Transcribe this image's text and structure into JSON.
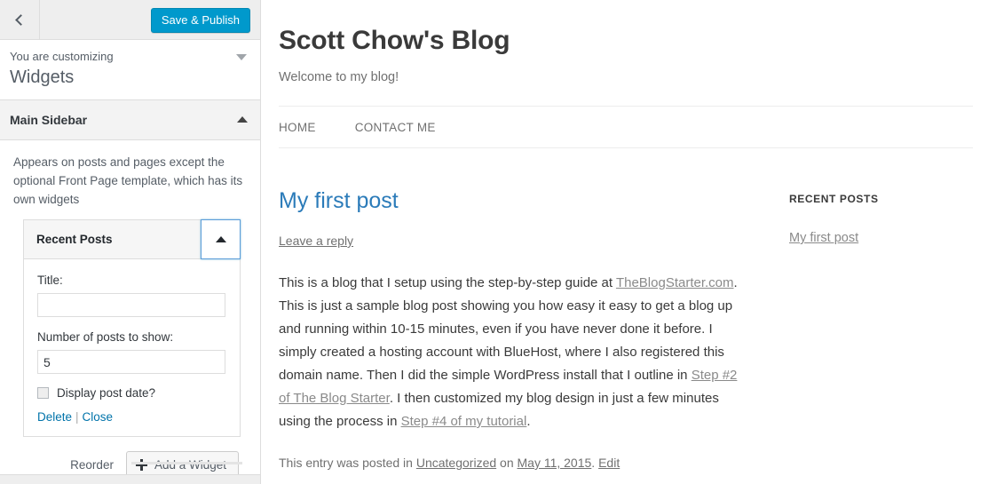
{
  "customizer": {
    "back_icon": "chevron-left-icon",
    "save_label": "Save & Publish",
    "accent_color": "#0099cc",
    "panel": {
      "eyebrow": "You are customizing",
      "title": "Widgets",
      "caret_icon": "caret-down-icon"
    },
    "section": {
      "label": "Main Sidebar",
      "caret_icon": "caret-up-icon",
      "description": "Appears on posts and pages except the optional Front Page template, which has its own widgets"
    },
    "widget": {
      "title": "Recent Posts",
      "toggle_icon": "caret-up-icon",
      "fields": {
        "title_label": "Title:",
        "title_value": "",
        "title_placeholder": "",
        "count_label": "Number of posts to show:",
        "count_value": "5",
        "checkbox_label": "Display post date?",
        "checkbox_checked": false
      },
      "actions": {
        "delete_label": "Delete",
        "separator": "|",
        "close_label": "Close"
      }
    },
    "footer": {
      "reorder_label": "Reorder",
      "add_widget_label": "Add a Widget",
      "add_widget_icon": "plus-icon"
    }
  },
  "preview": {
    "site_title": "Scott Chow's Blog",
    "site_description": "Welcome to my blog!",
    "nav": [
      {
        "label": "HOME"
      },
      {
        "label": "CONTACT ME"
      }
    ],
    "post": {
      "title": "My first post",
      "reply_link": "Leave a reply",
      "body": {
        "p1_a": "This is a blog that I setup using the step-by-step guide at ",
        "p1_link1": "TheBlogStarter.com",
        "p1_b": ". This is just a sample blog post showing you how easy it easy to get a blog up and running within 10-15 minutes, even if you have never done it before. I simply created a hosting account with BlueHost, where I also registered this domain name.  Then I did the simple WordPress install that I outline in ",
        "p1_link2": "Step #2 of The Blog Starter",
        "p1_c": ".  I then customized my blog design in just a few minutes using the process in ",
        "p1_link3": "Step #4 of my tutorial",
        "p1_d": "."
      },
      "footer": {
        "prefix": "This entry was posted in ",
        "category": "Uncategorized",
        "mid": " on ",
        "date": "May 11, 2015",
        "period": ". ",
        "edit": "Edit"
      }
    },
    "sidebar": {
      "heading": "RECENT POSTS",
      "items": [
        {
          "label": "My first post"
        }
      ]
    }
  }
}
